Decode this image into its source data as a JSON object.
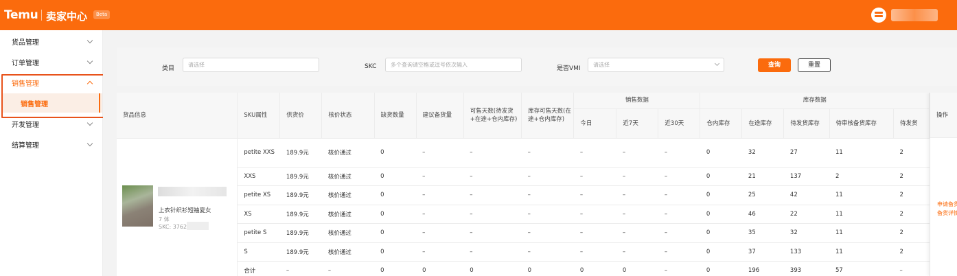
{
  "header": {
    "brand": "Temu",
    "app_title": "卖家中心",
    "beta": "Beta"
  },
  "sidebar": {
    "items": [
      {
        "label": "货品管理"
      },
      {
        "label": "订单管理"
      },
      {
        "label": "销售管理"
      },
      {
        "label": "开发管理"
      },
      {
        "label": "结算管理"
      }
    ],
    "active_sub": "销售管理"
  },
  "filters": {
    "category_label": "类目",
    "category_placeholder": "请选择",
    "skc_label": "SKC",
    "skc_placeholder": "多个查询请空格或逗号依次输入",
    "vmi_label": "是否VMI",
    "vmi_placeholder": "请选择",
    "query_button": "查询",
    "reset_button": "重置"
  },
  "table": {
    "headers": {
      "product_info": "货品信息",
      "sku_attr": "SKU属性",
      "supply_price": "供货价",
      "price_status": "核价状态",
      "shortage_qty": "缺货数量",
      "suggested_qty": "建议备货量",
      "days_sale_pending": "可售天数(待发货+在途+仓内库存)",
      "days_stock": "库存可售天数(在途+仓内库存)",
      "sales_group": "销售数据",
      "today": "今日",
      "last7": "近7天",
      "last30": "近30天",
      "inventory_group": "库存数据",
      "warehouse": "仓内库存",
      "in_transit": "在途库存",
      "pending_ship": "待发货库存",
      "pending_review": "待审核备货库存",
      "pending_ship2": "待发货",
      "operation": "操作"
    },
    "product": {
      "title": "上衣针织衫短袖夏女",
      "stock_label": "7 体",
      "skc": "SKC: 3762"
    },
    "rows": [
      {
        "sku": "petite XXS",
        "price": "189.9元",
        "status": "核价通过",
        "shortage": "0",
        "suggest": "–",
        "days1": "–",
        "days2": "–",
        "today": "–",
        "d7": "–",
        "d30": "–",
        "wh": "0",
        "transit": "32",
        "pending": "27",
        "review": "11",
        "ship": "2"
      },
      {
        "sku": "XXS",
        "price": "189.9元",
        "status": "核价通过",
        "shortage": "0",
        "suggest": "–",
        "days1": "–",
        "days2": "–",
        "today": "–",
        "d7": "–",
        "d30": "–",
        "wh": "0",
        "transit": "21",
        "pending": "137",
        "review": "2",
        "ship": "2"
      },
      {
        "sku": "petite XS",
        "price": "189.9元",
        "status": "核价通过",
        "shortage": "0",
        "suggest": "–",
        "days1": "–",
        "days2": "–",
        "today": "–",
        "d7": "–",
        "d30": "–",
        "wh": "0",
        "transit": "25",
        "pending": "42",
        "review": "11",
        "ship": "2"
      },
      {
        "sku": "XS",
        "price": "189.9元",
        "status": "核价通过",
        "shortage": "0",
        "suggest": "–",
        "days1": "–",
        "days2": "–",
        "today": "–",
        "d7": "–",
        "d30": "–",
        "wh": "0",
        "transit": "46",
        "pending": "22",
        "review": "11",
        "ship": "2"
      },
      {
        "sku": "petite S",
        "price": "189.9元",
        "status": "核价通过",
        "shortage": "0",
        "suggest": "–",
        "days1": "–",
        "days2": "–",
        "today": "–",
        "d7": "–",
        "d30": "–",
        "wh": "0",
        "transit": "35",
        "pending": "32",
        "review": "11",
        "ship": "2"
      },
      {
        "sku": "S",
        "price": "189.9元",
        "status": "核价通过",
        "shortage": "0",
        "suggest": "–",
        "days1": "–",
        "days2": "–",
        "today": "–",
        "d7": "–",
        "d30": "–",
        "wh": "0",
        "transit": "37",
        "pending": "133",
        "review": "11",
        "ship": "2"
      },
      {
        "sku": "合计",
        "price": "–",
        "status": "–",
        "shortage": "0",
        "suggest": "0",
        "days1": "0",
        "days2": "0",
        "today": "0",
        "d7": "0",
        "d30": "–",
        "wh": "0",
        "transit": "196",
        "pending": "393",
        "review": "57",
        "ship": "–"
      }
    ],
    "operations": {
      "apply_stock": "申请备货",
      "stock_detail": "备货详情"
    }
  }
}
